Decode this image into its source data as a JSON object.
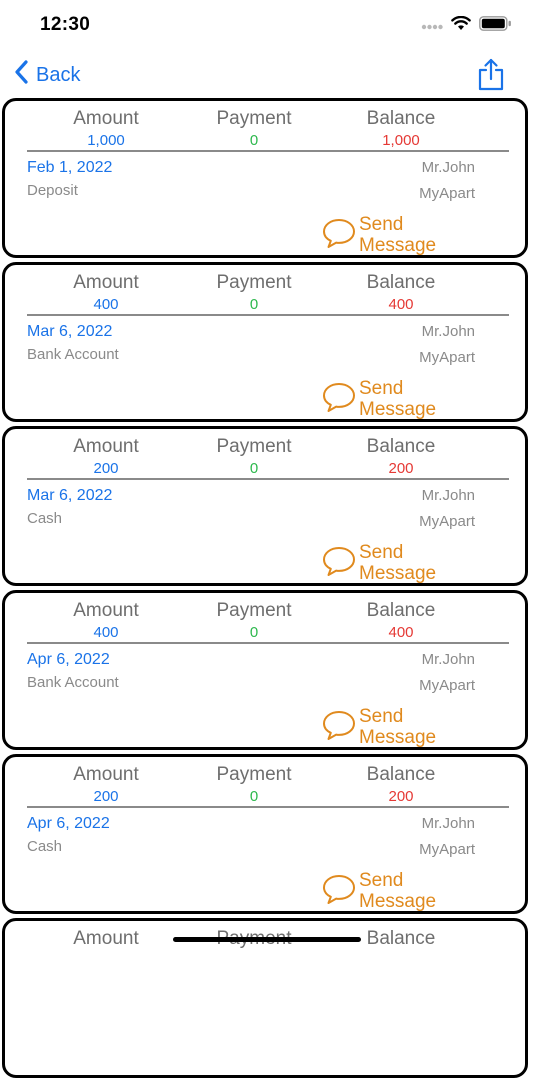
{
  "status_bar": {
    "time": "12:30"
  },
  "nav": {
    "back_label": "Back"
  },
  "columns": {
    "amount": "Amount",
    "payment": "Payment",
    "balance": "Balance"
  },
  "colors": {
    "accent_blue": "#1a73e8",
    "payment_green": "#2db84d",
    "balance_red": "#e53935",
    "send_orange": "#e08a1e"
  },
  "records": [
    {
      "amount": "1,000",
      "payment": "0",
      "balance": "1,000",
      "date": "Feb 1, 2022",
      "method": "Deposit",
      "name": "Mr.John",
      "property": "MyApart",
      "send_line1": "Send",
      "send_line2": "Message"
    },
    {
      "amount": "400",
      "payment": "0",
      "balance": "400",
      "date": "Mar 6, 2022",
      "method": "Bank Account",
      "name": "Mr.John",
      "property": "MyApart",
      "send_line1": "Send",
      "send_line2": "Message"
    },
    {
      "amount": "200",
      "payment": "0",
      "balance": "200",
      "date": "Mar 6, 2022",
      "method": "Cash",
      "name": "Mr.John",
      "property": "MyApart",
      "send_line1": "Send",
      "send_line2": "Message"
    },
    {
      "amount": "400",
      "payment": "0",
      "balance": "400",
      "date": "Apr 6, 2022",
      "method": "Bank Account",
      "name": "Mr.John",
      "property": "MyApart",
      "send_line1": "Send",
      "send_line2": "Message"
    },
    {
      "amount": "200",
      "payment": "0",
      "balance": "200",
      "date": "Apr 6, 2022",
      "method": "Cash",
      "name": "Mr.John",
      "property": "MyApart",
      "send_line1": "Send",
      "send_line2": "Message"
    }
  ]
}
